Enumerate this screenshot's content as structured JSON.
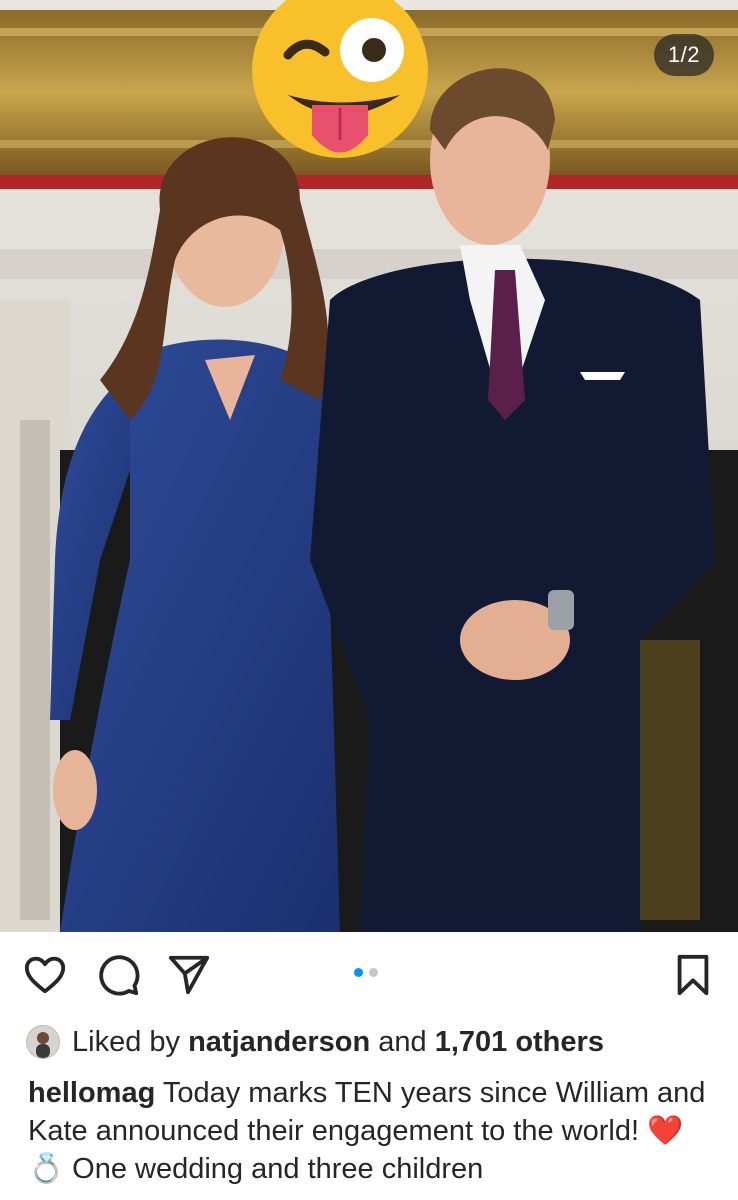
{
  "post": {
    "slide_counter": "1/2",
    "active_slide": 1,
    "slide_count": 2,
    "image_subject": "photo-couple-engagement",
    "sticker_icon": "winking-tongue-emoji-icon"
  },
  "actions": {
    "like_icon": "heart-icon",
    "comment_icon": "comment-bubble-icon",
    "share_icon": "paper-plane-icon",
    "save_icon": "bookmark-icon"
  },
  "likes": {
    "prefix": "Liked by",
    "user": "natjanderson",
    "middle": "and",
    "count": "1,701 others"
  },
  "caption": {
    "username": "hellomag",
    "text": "Today marks TEN years since William and Kate announced their engagement to the world! ❤️ 💍 One wedding and three children"
  },
  "colors": {
    "accent": "#0095f6",
    "text": "#262626",
    "dot_inactive": "#c7c7c7"
  }
}
